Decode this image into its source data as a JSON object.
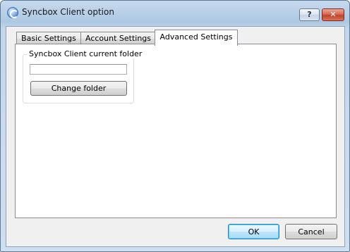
{
  "window": {
    "title": "Syncbox Client option",
    "help_label": "?",
    "close_label": "✕"
  },
  "tabs": [
    {
      "label": "Basic Settings",
      "active": false
    },
    {
      "label": "Account Settings",
      "active": false
    },
    {
      "label": "Advanced Settings",
      "active": true
    }
  ],
  "advanced": {
    "group_label": "Syncbox Client current folder",
    "folder_value": "",
    "change_folder_label": "Change folder"
  },
  "footer": {
    "ok_label": "OK",
    "cancel_label": "Cancel"
  },
  "colors": {
    "titlebar": "#b9d0e8",
    "close_button": "#c3432a",
    "default_button_border": "#3c7fb1",
    "panel_background": "#ffffff"
  }
}
